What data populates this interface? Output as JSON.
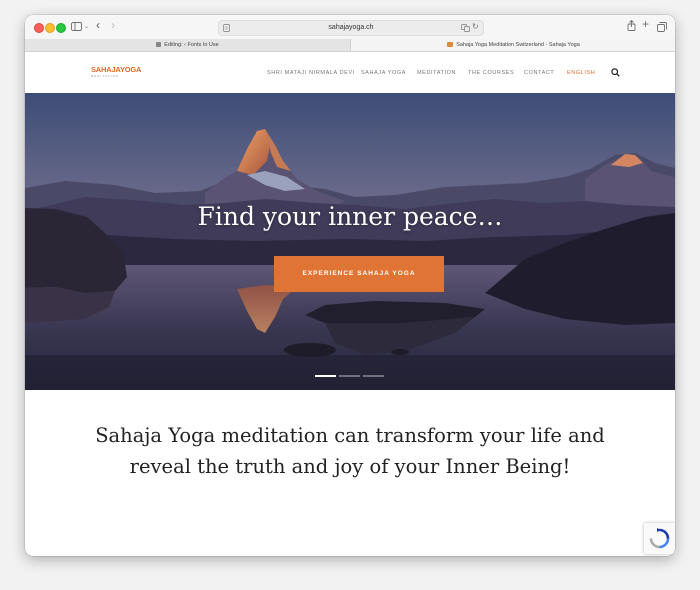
{
  "browser": {
    "address": "sahajayoga.ch",
    "tabs": [
      {
        "label": "Editing: ‹ Fonts In Use"
      },
      {
        "label": "Sahaja Yoga Meditation Switzerland - Sahaja Yoga"
      }
    ]
  },
  "site": {
    "logo": {
      "main": "SAHAJAYOGA",
      "sub": "MEDITATION"
    },
    "nav": [
      {
        "label": "SHRI MATAJI NIRMALA DEVI"
      },
      {
        "label": "SAHAJA YOGA"
      },
      {
        "label": "MEDITATION"
      },
      {
        "label": "THE COURSES"
      },
      {
        "label": "CONTACT"
      },
      {
        "label": "ENGLISH"
      }
    ],
    "hero": {
      "title": "Find your inner peace…",
      "cta": "EXPERIENCE SAHAJA YOGA",
      "active_slide": 1,
      "slide_count": 3
    },
    "intro": {
      "line1": "Sahaja Yoga meditation can transform your life and",
      "line2": "reveal the truth and joy of your Inner Being!"
    }
  },
  "colors": {
    "accent": "#df7434",
    "nav_active": "#e0692b",
    "hero_sky_top": "#3e4d77",
    "hero_sky_bottom": "#c6909e"
  }
}
